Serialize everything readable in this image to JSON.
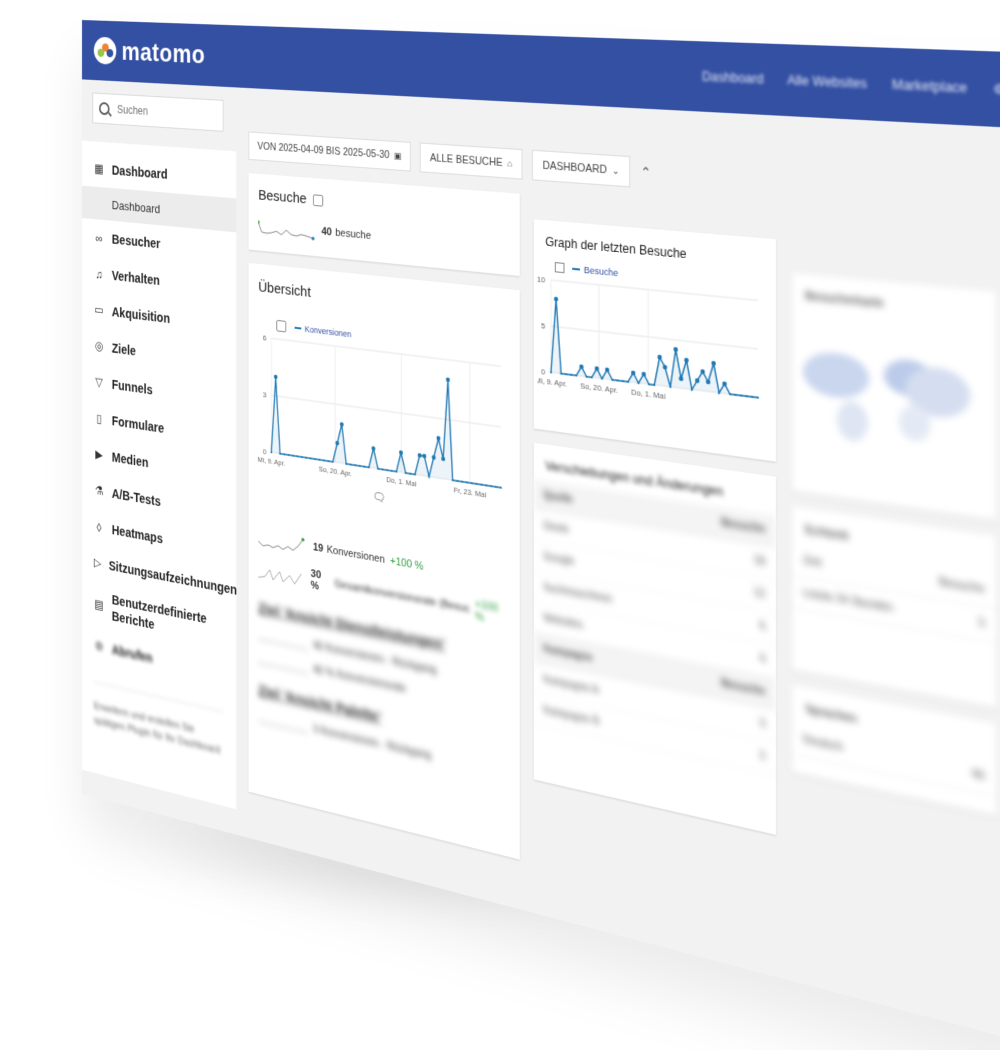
{
  "brand": {
    "name": "matomo",
    "colors": {
      "header": "#3450a3",
      "accent": "#1f78b4",
      "positive": "#2e9f3e"
    }
  },
  "topnav": {
    "items": [
      "Dashboard",
      "Alle Websites",
      "Marketplace"
    ]
  },
  "search": {
    "placeholder": "Suchen"
  },
  "toolbar": {
    "date_range": "VON 2025-04-09 BIS 2025-05-30",
    "segment": "ALLE BESUCHE",
    "dashboard": "DASHBOARD"
  },
  "sidebar": {
    "items": [
      {
        "label": "Dashboard",
        "icon": "grid-icon"
      },
      {
        "label": "Besucher",
        "icon": "glasses-icon"
      },
      {
        "label": "Verhalten",
        "icon": "bell-icon"
      },
      {
        "label": "Akquisition",
        "icon": "doc-icon"
      },
      {
        "label": "Ziele",
        "icon": "target-icon"
      },
      {
        "label": "Funnels",
        "icon": "funnel-icon"
      },
      {
        "label": "Formulare",
        "icon": "clipboard-icon"
      },
      {
        "label": "Medien",
        "icon": "media-icon"
      },
      {
        "label": "A/B-Tests",
        "icon": "flask-icon"
      },
      {
        "label": "Heatmaps",
        "icon": "drop-icon"
      },
      {
        "label": "Sitzungsaufzeichnungen",
        "icon": "play-icon"
      },
      {
        "label": "Benutzerdefinierte Berichte",
        "icon": "reports-icon"
      },
      {
        "label": "Abrufen",
        "icon": "gear-icon"
      }
    ],
    "sub_active": "Dashboard",
    "note": "Erweitern und erstellen Sie spätigen Plugin für Ihr Dashboard"
  },
  "widgets": {
    "visits": {
      "title": "Besuche",
      "count": "40",
      "unit": "besuche"
    },
    "overview": {
      "title": "Übersicht",
      "legend": "Konversionen",
      "conversions_value": "19",
      "conversions_label": "Konversionen",
      "conversions_change": "+100 %",
      "rate_value": "30 %",
      "rate_label": "Gesamtkonversionsrate (Besuche mit mindestens 1 Ziel)",
      "rate_change": "+100 %",
      "goal1_title": "Ziel 'Ansicht Dienstleistungen'",
      "goal1_a": "40 Konversionen - Rückgang",
      "goal1_b": "40 % Konversionsrate",
      "goal2_title": "Ziel 'Ansicht Palette'",
      "goal2_a": "3 Konversionen - Rückgang"
    },
    "graph": {
      "title": "Graph der letzten Besuche",
      "legend": "Besuche"
    },
    "referrers": {
      "title": "Verschiebungen und Änderungen"
    },
    "map": {
      "title": "Besucherkarte"
    },
    "realtime": {
      "title": "Echtzeit"
    },
    "languages": {
      "title": "Sprachen"
    }
  },
  "chart_data": [
    {
      "type": "line",
      "title": "Übersicht",
      "series": [
        {
          "name": "Konversionen",
          "values": [
            0,
            4,
            0,
            0,
            0,
            0,
            0,
            0,
            0,
            0,
            0,
            0,
            0,
            0,
            0,
            1,
            2,
            0,
            0,
            0,
            0,
            0,
            0,
            1,
            0,
            0,
            0,
            0,
            0,
            1,
            0,
            0,
            0,
            1,
            1,
            0,
            1,
            2,
            1,
            5,
            0,
            0,
            0,
            0,
            0,
            0,
            0,
            0,
            0,
            0,
            0
          ]
        }
      ],
      "xticks": [
        "Mi, 9. Apr.",
        "So, 20. Apr.",
        "Do, 1. Mai",
        "Fr, 23. Mai"
      ],
      "yticks": [
        "0",
        "3",
        "6"
      ],
      "ylim": [
        0,
        6
      ],
      "grid": true
    },
    {
      "type": "line",
      "title": "Graph der letzten Besuche",
      "series": [
        {
          "name": "Besuche",
          "values": [
            0,
            8,
            0,
            0,
            0,
            0,
            1,
            0,
            0,
            1,
            0,
            1,
            0,
            0,
            0,
            0,
            1,
            0,
            1,
            0,
            0,
            3,
            2,
            0,
            4,
            1,
            3,
            0,
            1,
            2,
            1,
            3,
            0,
            1,
            0,
            0,
            0,
            0,
            0,
            0
          ]
        }
      ],
      "xticks": [
        "Mi, 9. Apr.",
        "So, 20. Apr.",
        "Do, 1. Mai"
      ],
      "yticks": [
        "0",
        "5",
        "10"
      ],
      "ylim": [
        0,
        10
      ],
      "grid": true
    }
  ]
}
